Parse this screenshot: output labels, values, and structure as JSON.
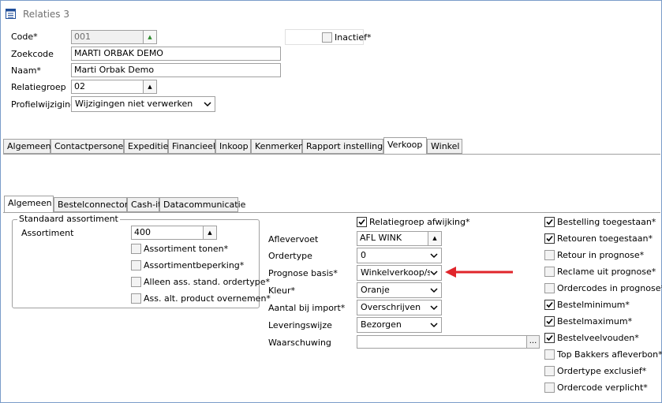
{
  "window": {
    "title": "Relaties 3"
  },
  "header": {
    "code_label": "Code*",
    "code_value": "001",
    "inactief_label": "Inactief*",
    "zoekcode_label": "Zoekcode",
    "zoekcode_value": "MARTI ORBAK DEMO",
    "naam_label": "Naam*",
    "naam_value": "Marti Orbak Demo",
    "relatiegroep_label": "Relatiegroep",
    "relatiegroep_value": "02",
    "profiel_label": "Profielwijziging*",
    "profiel_value": "Wijzigingen niet verwerken"
  },
  "main_tabs": [
    "Algemeen",
    "Contactpersonen",
    "Expeditie",
    "Financieel",
    "Inkoop",
    "Kenmerken",
    "Rapport instellingen",
    "Verkoop",
    "Winkel"
  ],
  "main_tab_active": "Verkoop",
  "sub_tabs": [
    "Algemeen",
    "Bestelconnector",
    "Cash-it",
    "Datacommunicatie"
  ],
  "sub_tab_active": "Algemeen",
  "assortiment": {
    "group_label": "Standaard assortiment",
    "assortiment_label": "Assortiment",
    "assortiment_value": "400",
    "checks": [
      {
        "label": "Assortiment tonen*",
        "checked": false
      },
      {
        "label": "Assortimentbeperking*",
        "checked": false
      },
      {
        "label": "Alleen ass. stand. ordertype*",
        "checked": false
      },
      {
        "label": "Ass. alt. product overnemen*",
        "checked": false
      }
    ]
  },
  "middle": {
    "relatiegroep_afwijking_label": "Relatiegroep afwijking*",
    "relatiegroep_afwijking_checked": true,
    "aflevervoet_label": "Aflevervoet",
    "aflevervoet_value": "AFL WINK",
    "ordertype_label": "Ordertype",
    "ordertype_value": "0",
    "prognose_label": "Prognose basis*",
    "prognose_value": "Winkelverkoop/st",
    "kleur_label": "Kleur*",
    "kleur_value": "Oranje",
    "aantal_label": "Aantal bij import*",
    "aantal_value": "Overschrijven",
    "levering_label": "Leveringswijze",
    "levering_value": "Bezorgen",
    "waarschuwing_label": "Waarschuwing",
    "waarschuwing_value": "",
    "ellipsis_label": "..."
  },
  "right_checks": [
    {
      "label": "Bestelling toegestaan*",
      "checked": true
    },
    {
      "label": "Retouren toegestaan*",
      "checked": true
    },
    {
      "label": "Retour in prognose*",
      "checked": false
    },
    {
      "label": "Reclame uit prognose*",
      "checked": false
    },
    {
      "label": "Ordercodes in prognose*",
      "checked": false
    },
    {
      "label": "Bestelminimum*",
      "checked": true
    },
    {
      "label": "Bestelmaximum*",
      "checked": true
    },
    {
      "label": "Bestelveelvouden*",
      "checked": true
    },
    {
      "label": "Top Bakkers afleverbon*",
      "checked": false
    },
    {
      "label": "Ordertype exclusief*",
      "checked": false
    },
    {
      "label": "Ordercode verplicht*",
      "checked": false
    }
  ],
  "annotation": {
    "arrow_color": "#e0252b"
  },
  "colors": {
    "accent_window_border": "#7a9cc9",
    "spinner_up": "#2e8b2e"
  }
}
